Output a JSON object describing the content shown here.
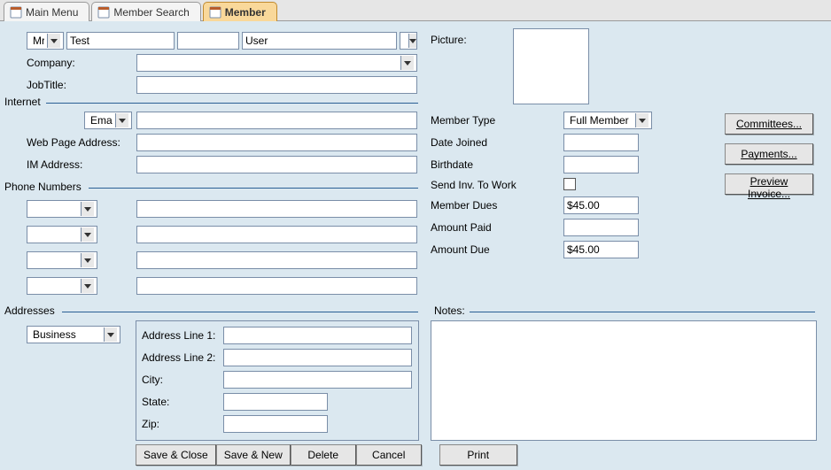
{
  "tabs": {
    "main_menu": "Main Menu",
    "member_search": "Member Search",
    "member": "Member"
  },
  "name": {
    "title": "Mr.",
    "first": "Test",
    "middle": "",
    "last": "User",
    "suffix": ""
  },
  "company": {
    "label": "Company:",
    "value": ""
  },
  "jobtitle": {
    "label": "JobTitle:",
    "value": ""
  },
  "picture": {
    "label": "Picture:"
  },
  "internet": {
    "group": "Internet",
    "channel": "Email",
    "channel_value": "",
    "webpage_label": "Web Page Address:",
    "webpage_value": "",
    "im_label": "IM Address:",
    "im_value": ""
  },
  "phones": {
    "group": "Phone Numbers",
    "rows": [
      "",
      "",
      "",
      ""
    ]
  },
  "membership": {
    "type_label": "Member Type",
    "type_value": "Full Member",
    "date_joined_label": "Date Joined",
    "date_joined_value": "",
    "birthdate_label": "Birthdate",
    "birthdate_value": "",
    "send_inv_label": "Send Inv. To Work",
    "dues_label": "Member Dues",
    "dues_value": "$45.00",
    "paid_label": "Amount Paid",
    "paid_value": "",
    "due_label": "Amount Due",
    "due_value": "$45.00"
  },
  "addresses": {
    "group": "Addresses",
    "type": "Business",
    "line1_label": "Address Line 1:",
    "line1": "",
    "line2_label": "Address Line 2:",
    "line2": "",
    "city_label": "City:",
    "city": "",
    "state_label": "State:",
    "state": "",
    "zip_label": "Zip:",
    "zip": ""
  },
  "notes": {
    "label": "Notes:",
    "value": ""
  },
  "side": {
    "committees": "Committees...",
    "payments": "Payments...",
    "preview": "Preview Invoice..."
  },
  "bottom": {
    "save_close": "Save & Close",
    "save_new": "Save & New",
    "delete": "Delete",
    "cancel": "Cancel",
    "print": "Print"
  }
}
